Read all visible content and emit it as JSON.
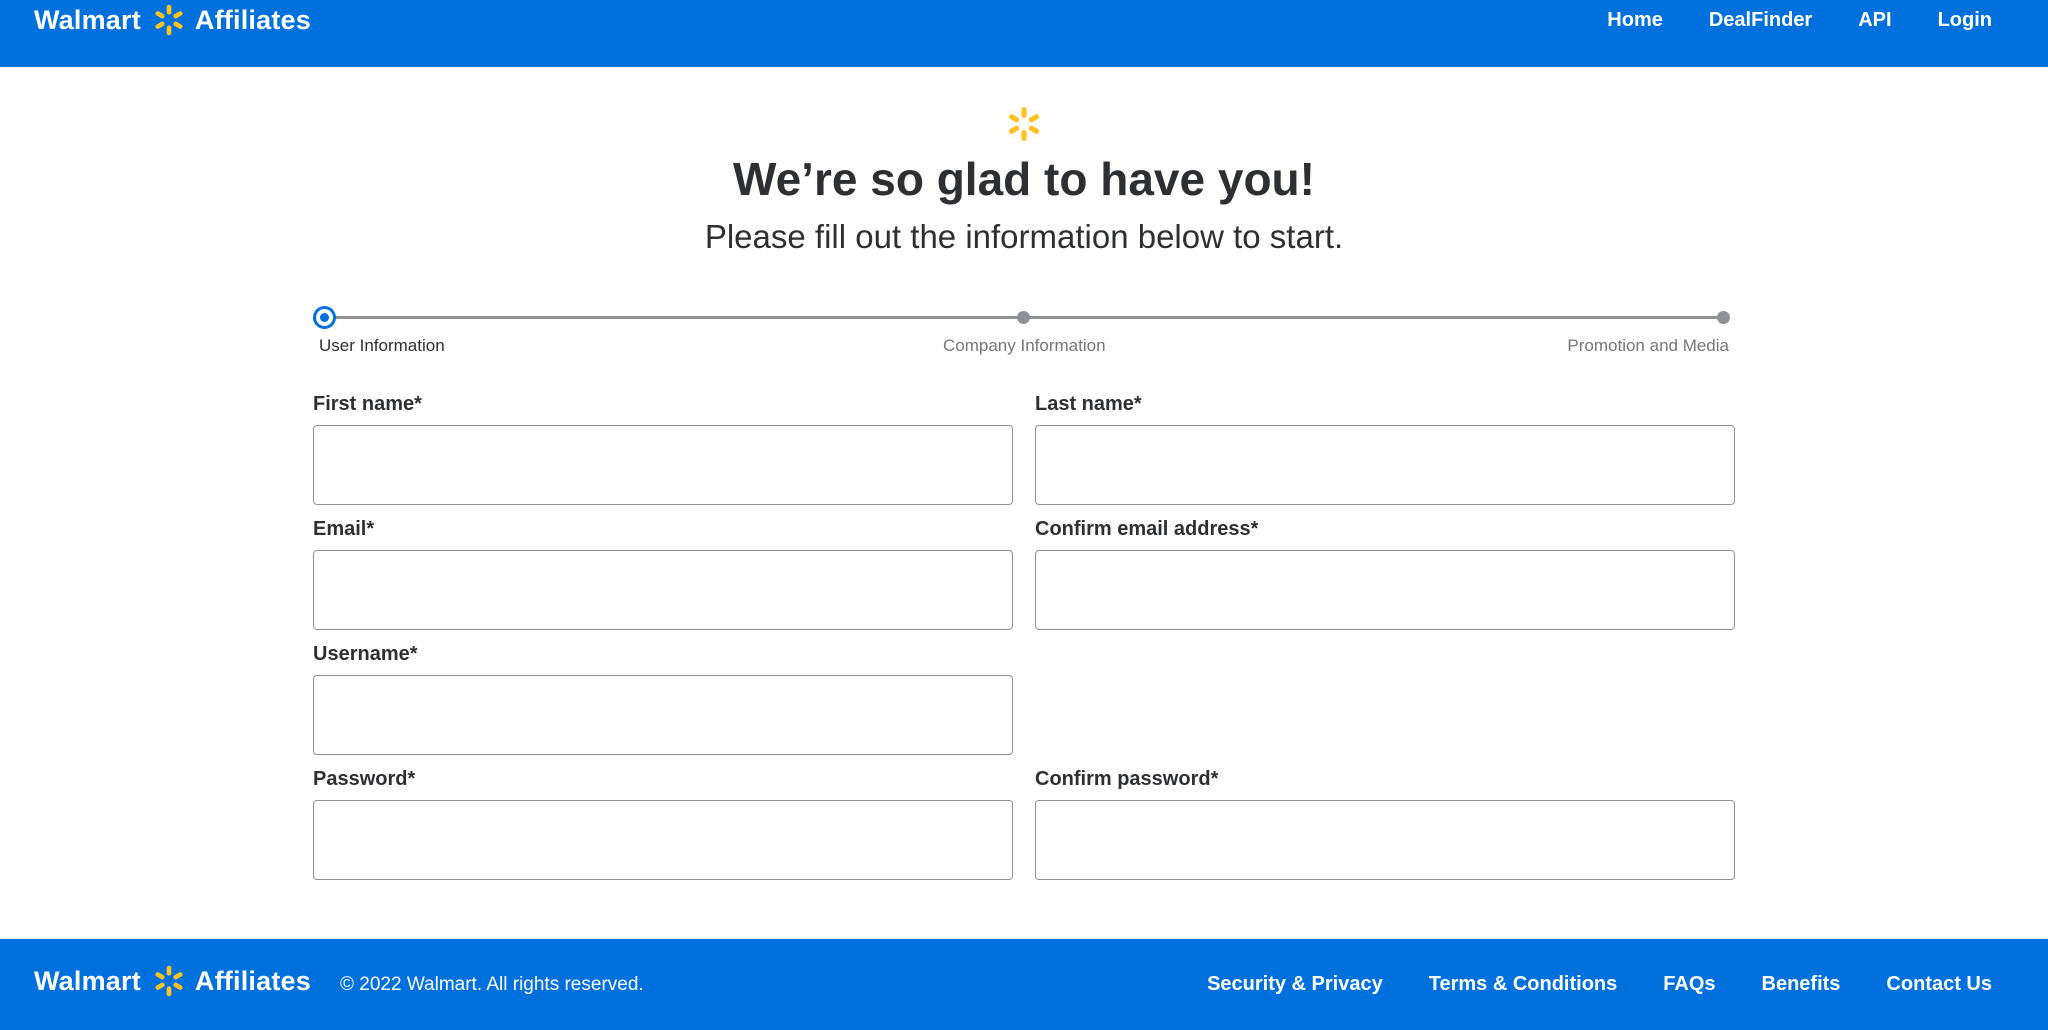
{
  "brand": {
    "left_word": "Walmart",
    "right_word": "Affiliates",
    "spark_color": "#ffc220"
  },
  "colors": {
    "header_bg": "#0071dc",
    "footer_bg": "#0071dc",
    "accent": "#0071dc",
    "spark": "#ffc220",
    "text": "#2e2f32",
    "muted": "#74767c",
    "track": "#909196"
  },
  "nav": {
    "items": [
      {
        "label": "Home"
      },
      {
        "label": "DealFinder"
      },
      {
        "label": "API"
      },
      {
        "label": "Login"
      }
    ]
  },
  "hero": {
    "icon": "spark-icon",
    "title": "We’re so glad to have you!",
    "subtitle": "Please fill out the information below to start."
  },
  "stepper": {
    "steps": [
      {
        "label": "User Information",
        "state": "active"
      },
      {
        "label": "Company Information",
        "state": "inactive"
      },
      {
        "label": "Promotion and Media",
        "state": "inactive"
      }
    ]
  },
  "form": {
    "first_name": {
      "label": "First name*",
      "value": ""
    },
    "last_name": {
      "label": "Last name*",
      "value": ""
    },
    "email": {
      "label": "Email*",
      "value": ""
    },
    "confirm_email": {
      "label": "Confirm email address*",
      "value": ""
    },
    "username": {
      "label": "Username*",
      "value": ""
    },
    "password": {
      "label": "Password*",
      "value": ""
    },
    "confirm_password": {
      "label": "Confirm password*",
      "value": ""
    }
  },
  "footer": {
    "copyright": "© 2022 Walmart. All rights reserved.",
    "links": [
      {
        "label": "Security & Privacy"
      },
      {
        "label": "Terms & Conditions"
      },
      {
        "label": "FAQs"
      },
      {
        "label": "Benefits"
      },
      {
        "label": "Contact Us"
      }
    ]
  }
}
